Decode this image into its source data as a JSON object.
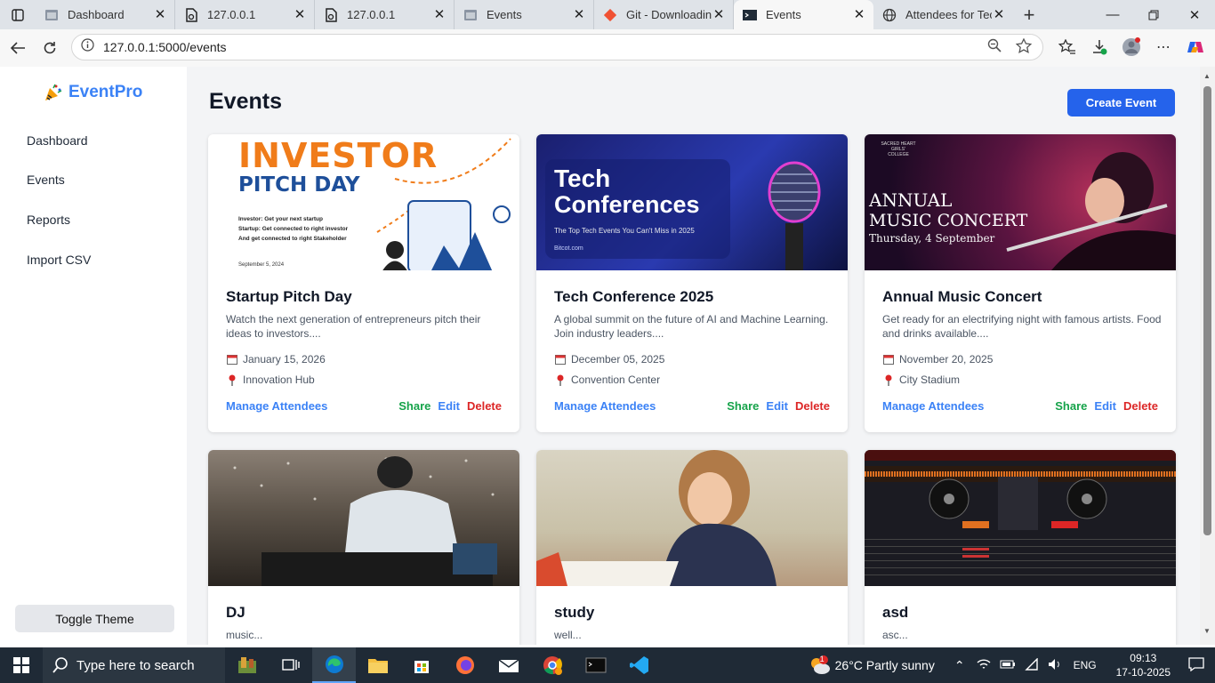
{
  "browser": {
    "tabs": [
      {
        "label": "Dashboard",
        "icon": "page-icon"
      },
      {
        "label": "127.0.0.1",
        "icon": "file-icon"
      },
      {
        "label": "127.0.0.1",
        "icon": "file-icon"
      },
      {
        "label": "Events",
        "icon": "page-icon"
      },
      {
        "label": "Git - Downloading",
        "icon": "git-icon"
      },
      {
        "label": "Events",
        "icon": "terminal-icon",
        "active": true
      },
      {
        "label": "Attendees for Tech",
        "icon": "globe-icon"
      }
    ],
    "url": "127.0.0.1:5000/events"
  },
  "sidebar": {
    "brand": "EventPro",
    "items": [
      {
        "label": "Dashboard"
      },
      {
        "label": "Events"
      },
      {
        "label": "Reports"
      },
      {
        "label": "Import CSV"
      }
    ],
    "toggle_label": "Toggle Theme"
  },
  "main": {
    "title": "Events",
    "create_label": "Create Event",
    "manage_label": "Manage Attendees",
    "share_label": "Share",
    "edit_label": "Edit",
    "delete_label": "Delete",
    "cards": [
      {
        "title": "Startup Pitch Day",
        "desc": "Watch the next generation of entrepreneurs pitch their ideas to investors....",
        "date": "January 15, 2026",
        "location": "Innovation Hub",
        "img_text1": "INVESTOR",
        "img_text2": "PITCH DAY",
        "img_bullets": [
          "Investor: Get your next startup",
          "Startup: Get connected to right investor",
          "And get connected to right Stakeholder"
        ],
        "img_date": "September 5, 2024"
      },
      {
        "title": "Tech Conference 2025",
        "desc": "A global summit on the future of AI and Machine Learning. Join industry leaders....",
        "date": "December 05, 2025",
        "location": "Convention Center",
        "img_text1": "Tech",
        "img_text2": "Conferences",
        "img_sub": "The Top Tech Events You Can't Miss in 2025",
        "img_brand": "Bitcot.com"
      },
      {
        "title": "Annual Music Concert",
        "desc": "Get ready for an electrifying night with famous artists. Food and drinks available....",
        "date": "November 20, 2025",
        "location": "City Stadium",
        "img_text1": "ANNUAL",
        "img_text2": "MUSIC CONCERT",
        "img_sub": "Thursday, 4 September",
        "img_brand": "SACRED HEART GIRLS' COLLEGE"
      },
      {
        "title": "DJ",
        "desc": "music..."
      },
      {
        "title": "study",
        "desc": "well..."
      },
      {
        "title": "asd",
        "desc": "asc..."
      }
    ]
  },
  "taskbar": {
    "search_placeholder": "Type here to search",
    "weather": "26°C  Partly sunny",
    "lang": "ENG",
    "time": "09:13",
    "date": "17-10-2025",
    "notif_count": "1"
  },
  "colors": {
    "accent": "#3b82f6",
    "share": "#16a34a",
    "delete": "#dc2626",
    "create": "#2563eb"
  }
}
